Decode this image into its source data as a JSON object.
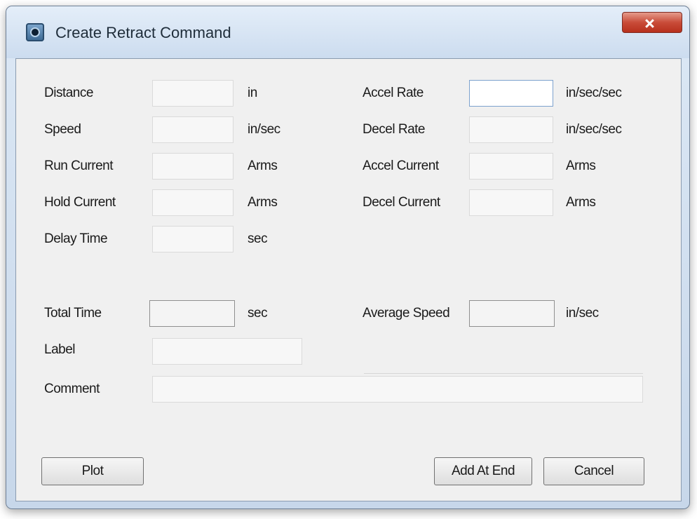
{
  "window": {
    "title": "Create Retract Command"
  },
  "left_fields": [
    {
      "label": "Distance",
      "unit": "in",
      "value": ""
    },
    {
      "label": "Speed",
      "unit": "in/sec",
      "value": ""
    },
    {
      "label": "Run Current",
      "unit": "Arms",
      "value": ""
    },
    {
      "label": "Hold Current",
      "unit": "Arms",
      "value": ""
    },
    {
      "label": "Delay Time",
      "unit": "sec",
      "value": ""
    }
  ],
  "right_fields": [
    {
      "label": "Accel Rate",
      "unit": "in/sec/sec",
      "value": ""
    },
    {
      "label": "Decel Rate",
      "unit": "in/sec/sec",
      "value": ""
    },
    {
      "label": "Accel Current",
      "unit": "Arms",
      "value": ""
    },
    {
      "label": "Decel Current",
      "unit": "Arms",
      "value": ""
    }
  ],
  "summary": {
    "total_time": {
      "label": "Total Time",
      "unit": "sec",
      "value": ""
    },
    "average_speed": {
      "label": "Average Speed",
      "unit": "in/sec",
      "value": ""
    }
  },
  "meta": {
    "label": {
      "label": "Label",
      "value": ""
    },
    "comment": {
      "label": "Comment",
      "value": ""
    }
  },
  "buttons": {
    "plot": "Plot",
    "add_at_end": "Add At End",
    "cancel": "Cancel"
  },
  "icons": {
    "app": "app-gear-icon",
    "close": "close-icon"
  },
  "colors": {
    "titlebar": "#dce8f5",
    "close_button": "#c94c39",
    "client_background": "#f0f0f0"
  }
}
